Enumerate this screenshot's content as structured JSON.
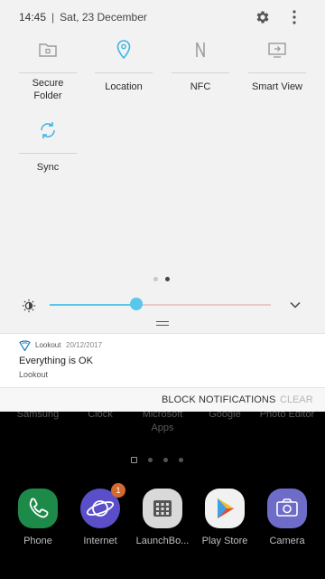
{
  "status_bar": {
    "time": "14:45",
    "separator": "|",
    "date": "Sat, 23 December",
    "settings_icon": "gear-icon",
    "more_icon": "kebab-icon"
  },
  "quick_settings": {
    "tiles": [
      {
        "label": "Secure\nFolder",
        "icon": "secure-folder-icon",
        "active": false
      },
      {
        "label": "Location",
        "icon": "location-pin-icon",
        "active": true
      },
      {
        "label": "NFC",
        "icon": "nfc-icon",
        "active": false
      },
      {
        "label": "Smart View",
        "icon": "smart-view-icon",
        "active": false
      },
      {
        "label": "Sync",
        "icon": "sync-icon",
        "active": true
      }
    ],
    "page_count": 2,
    "current_page": 2
  },
  "brightness": {
    "level": 0.39,
    "icon": "brightness-icon",
    "expand_icon": "chevron-down-icon"
  },
  "notification": {
    "app": "Lookout",
    "time": "20/12/2017",
    "title": "Everything is OK",
    "subtitle": "Lookout",
    "icon": "lookout-shield-icon",
    "block_label": "BLOCK NOTIFICATIONS",
    "clear_label": "CLEAR"
  },
  "home": {
    "app_labels": [
      "Samsung",
      "Clock",
      "Microsoft\nApps",
      "Google",
      "Photo Editor"
    ],
    "dock": [
      {
        "name": "Phone",
        "icon": "phone-icon",
        "color": "#1e8a4a"
      },
      {
        "name": "Internet",
        "icon": "internet-planet-icon",
        "color": "#5b4fc9",
        "badge": "1"
      },
      {
        "name": "LaunchBo...",
        "icon": "launchbox-icon",
        "color": "#d9d9d9"
      },
      {
        "name": "Play Store",
        "icon": "play-store-icon",
        "color": "#f1f1f1"
      },
      {
        "name": "Camera",
        "icon": "camera-icon",
        "color": "#6e6cc9"
      }
    ]
  },
  "colors": {
    "accent": "#59c7ea",
    "shade_bg": "#f2f2f2"
  }
}
